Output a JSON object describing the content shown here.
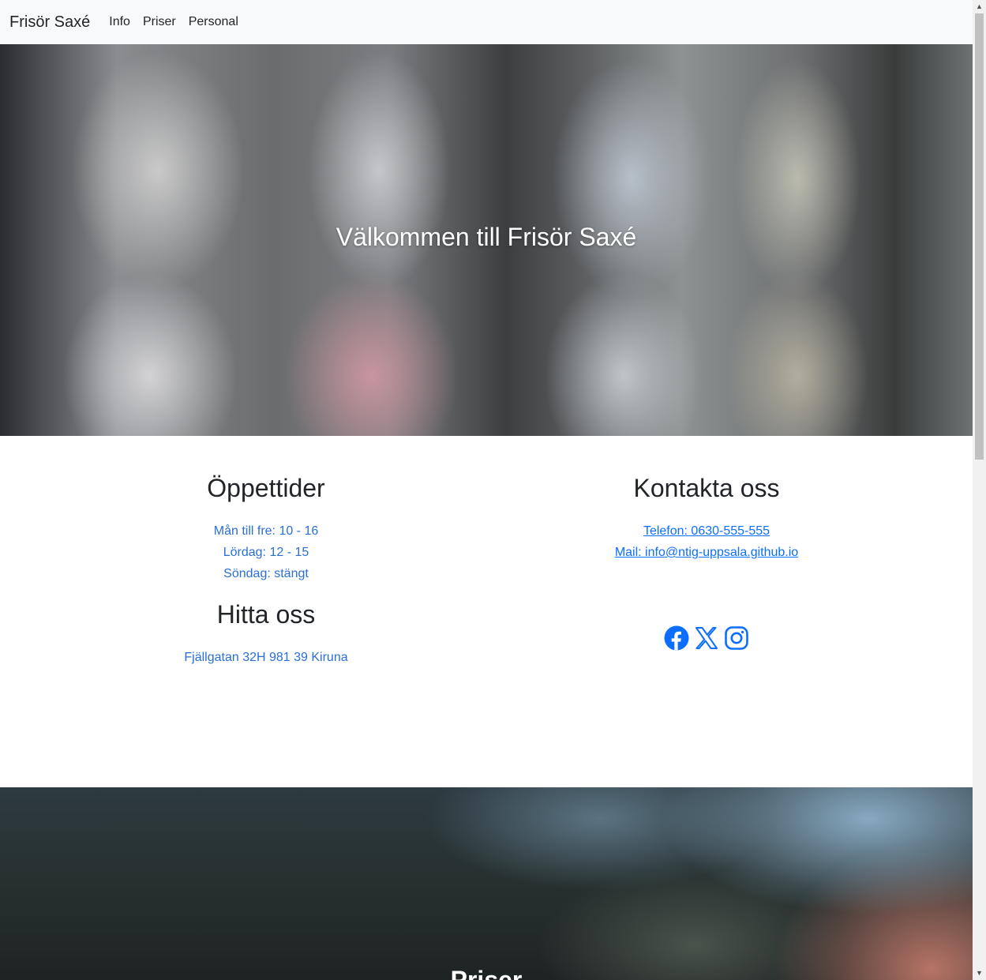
{
  "navbar": {
    "brand": "Frisör Saxé",
    "links": [
      "Info",
      "Priser",
      "Personal"
    ]
  },
  "hero": {
    "title": "Välkommen till Frisör Saxé"
  },
  "hours": {
    "heading": "Öppettider",
    "lines": [
      "Mån till fre: 10 - 16",
      "Lördag: 12 - 15",
      "Söndag: stängt"
    ]
  },
  "location": {
    "heading": "Hitta oss",
    "address": "Fjällgatan 32H 981 39 Kiruna"
  },
  "contact": {
    "heading": "Kontakta oss",
    "phone": "Telefon: 0630-555-555",
    "mail": "Mail: info@ntig-uppsala.github.io"
  },
  "socials": [
    "facebook-icon",
    "x-icon",
    "instagram-icon"
  ],
  "priser": {
    "title": "Priser"
  },
  "colors": {
    "link": "#0d6efd",
    "muted_link": "#2a6fd6",
    "navbar_bg": "#f8f9fa"
  }
}
